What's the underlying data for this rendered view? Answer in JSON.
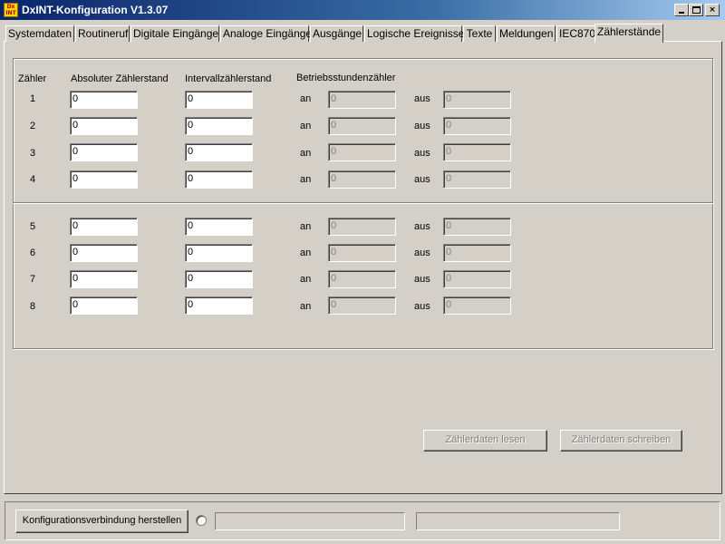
{
  "window": {
    "title": "DxINT-Konfiguration V1.3.07",
    "icon_text": [
      "Dx",
      "INT"
    ],
    "close_symbol": "×"
  },
  "tabs": [
    {
      "label": "Systemdaten"
    },
    {
      "label": "Routineruf"
    },
    {
      "label": "Digitale Eingänge"
    },
    {
      "label": "Analoge Eingänge"
    },
    {
      "label": "Ausgänge"
    },
    {
      "label": "Logische Ereignisse"
    },
    {
      "label": "Texte"
    },
    {
      "label": "Meldungen"
    },
    {
      "label": "IEC870"
    },
    {
      "label": "Zählerstände",
      "active": true
    }
  ],
  "counters": {
    "headers": {
      "counter": "Zähler",
      "absolute": "Absoluter Zählerstand",
      "interval": "Intervallzählerstand",
      "operating_hours": "Betriebsstundenzähler"
    },
    "on_label": "an",
    "off_label": "aus",
    "rows": [
      {
        "id": "1",
        "absolute": "0",
        "interval": "0",
        "on": "0",
        "off": "0"
      },
      {
        "id": "2",
        "absolute": "0",
        "interval": "0",
        "on": "0",
        "off": "0"
      },
      {
        "id": "3",
        "absolute": "0",
        "interval": "0",
        "on": "0",
        "off": "0"
      },
      {
        "id": "4",
        "absolute": "0",
        "interval": "0",
        "on": "0",
        "off": "0"
      },
      {
        "id": "5",
        "absolute": "0",
        "interval": "0",
        "on": "0",
        "off": "0"
      },
      {
        "id": "6",
        "absolute": "0",
        "interval": "0",
        "on": "0",
        "off": "0"
      },
      {
        "id": "7",
        "absolute": "0",
        "interval": "0",
        "on": "0",
        "off": "0"
      },
      {
        "id": "8",
        "absolute": "0",
        "interval": "0",
        "on": "0",
        "off": "0"
      }
    ]
  },
  "actions": {
    "read_label": "Zählerdaten lesen",
    "write_label": "Zählerdaten schreiben"
  },
  "status": {
    "connect_label": "Konfigurationsverbindung herstellen",
    "field1": "",
    "field2": ""
  }
}
